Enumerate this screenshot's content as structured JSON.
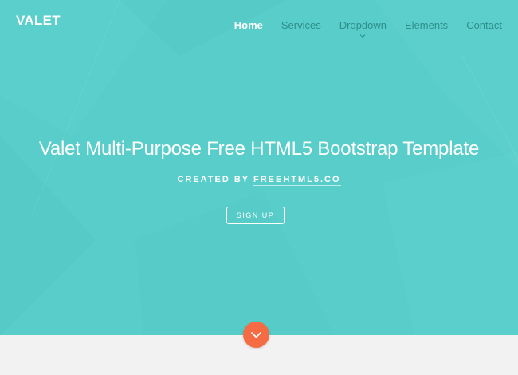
{
  "brand": {
    "name": "VALET"
  },
  "nav": {
    "items": [
      {
        "label": "Home",
        "active": true
      },
      {
        "label": "Services",
        "active": false
      },
      {
        "label": "Dropdown",
        "active": false,
        "has_submenu": true
      },
      {
        "label": "Elements",
        "active": false
      },
      {
        "label": "Contact",
        "active": false
      }
    ]
  },
  "hero": {
    "title": "Valet Multi-Purpose Free HTML5 Bootstrap Template",
    "credit_prefix": "CREATED BY",
    "credit_link": "FREEHTML5.CO",
    "cta_label": "SIGN UP",
    "scroll_icon": "chevron-down-icon"
  },
  "colors": {
    "hero_background": "#58cdc9",
    "nav_text": "#2e8f8b",
    "accent": "#f56b43",
    "page_background": "#f3f2f3"
  }
}
